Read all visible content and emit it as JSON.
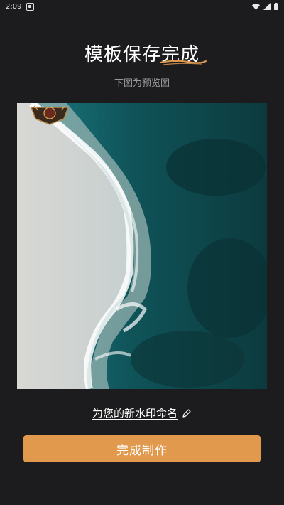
{
  "status_bar": {
    "time": "2:09",
    "icons": [
      "notification-icon",
      "wifi-icon",
      "signal-icon",
      "battery-icon"
    ]
  },
  "header": {
    "title": "模板保存完成",
    "subtitle": "下图为预览图"
  },
  "preview": {
    "alt": "aerial beach preview with watermark"
  },
  "actions": {
    "rename_label": "为您的新水印命名",
    "finish_label": "完成制作"
  },
  "colors": {
    "background": "#1c1c1e",
    "accent": "#e1994d",
    "subtitle": "#9a9a9a"
  }
}
